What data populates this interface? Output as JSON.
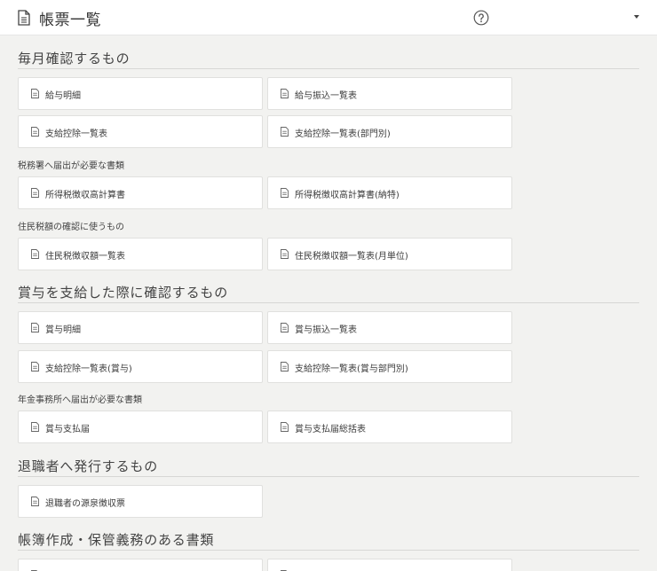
{
  "header": {
    "title": "帳票一覧"
  },
  "sections": {
    "monthly": {
      "title": "毎月確認するもの",
      "cards": [
        "給与明細",
        "給与振込一覧表",
        "支給控除一覧表",
        "支給控除一覧表(部門別)"
      ],
      "tax_office": {
        "title": "税務署へ届出が必要な書類",
        "cards": [
          "所得税徴収高計算書",
          "所得税徴収高計算書(納特)"
        ]
      },
      "resident": {
        "title": "住民税額の確認に使うもの",
        "cards": [
          "住民税徴収額一覧表",
          "住民税徴収額一覧表(月単位)"
        ]
      }
    },
    "bonus": {
      "title": "賞与を支給した際に確認するもの",
      "cards": [
        "賞与明細",
        "賞与振込一覧表",
        "支給控除一覧表(賞与)",
        "支給控除一覧表(賞与部門別)"
      ],
      "pension": {
        "title": "年金事務所へ届出が必要な書類",
        "cards": [
          "賞与支払届",
          "賞与支払届総括表"
        ]
      }
    },
    "retiree": {
      "title": "退職者へ発行するもの",
      "cards": [
        "退職者の源泉徴収票"
      ]
    },
    "books": {
      "title": "帳簿作成・保管義務のある書類"
    }
  }
}
